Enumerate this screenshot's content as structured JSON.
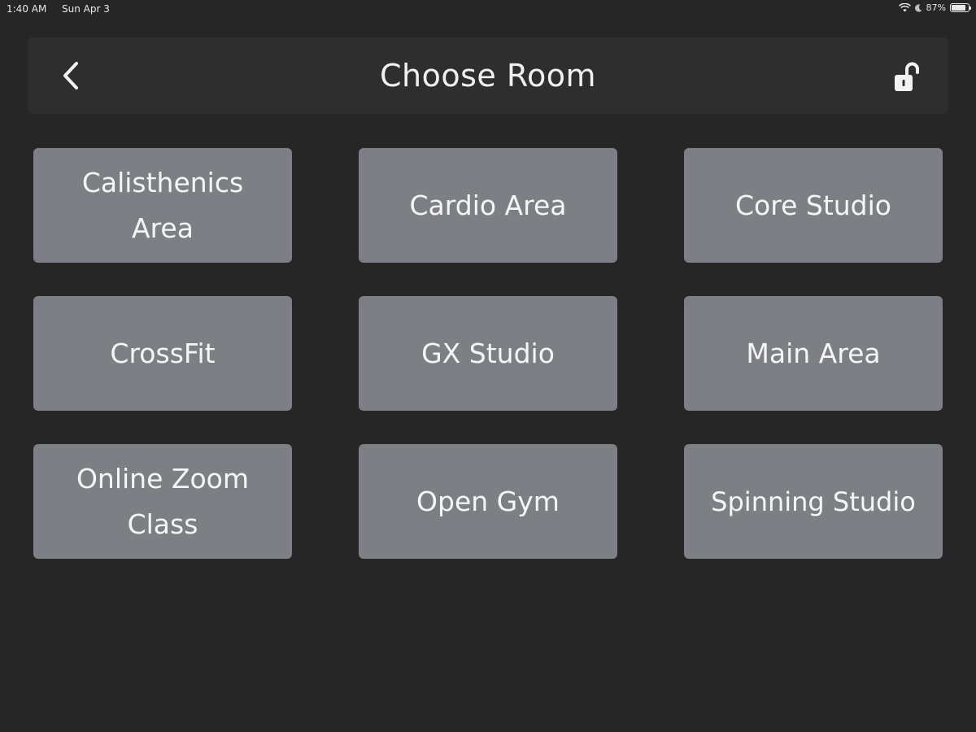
{
  "status_bar": {
    "time": "1:40 AM",
    "date": "Sun Apr 3",
    "battery_percent": "87%",
    "battery_level": 0.87,
    "icons": [
      "wifi-icon",
      "moon-icon",
      "battery-icon"
    ]
  },
  "header": {
    "title": "Choose Room",
    "back_icon": "chevron-left-icon",
    "lock_icon": "lock-open-icon"
  },
  "rooms": [
    {
      "label": "Calisthenics Area"
    },
    {
      "label": "Cardio Area"
    },
    {
      "label": "Core Studio"
    },
    {
      "label": "CrossFit"
    },
    {
      "label": "GX Studio"
    },
    {
      "label": "Main Area"
    },
    {
      "label": "Online Zoom Class"
    },
    {
      "label": "Open Gym"
    },
    {
      "label": "Spinning Studio"
    }
  ],
  "colors": {
    "background": "#262626",
    "header_background": "#2f2e2f",
    "tile_background": "#7c8085",
    "text": "#f5f5f5"
  }
}
